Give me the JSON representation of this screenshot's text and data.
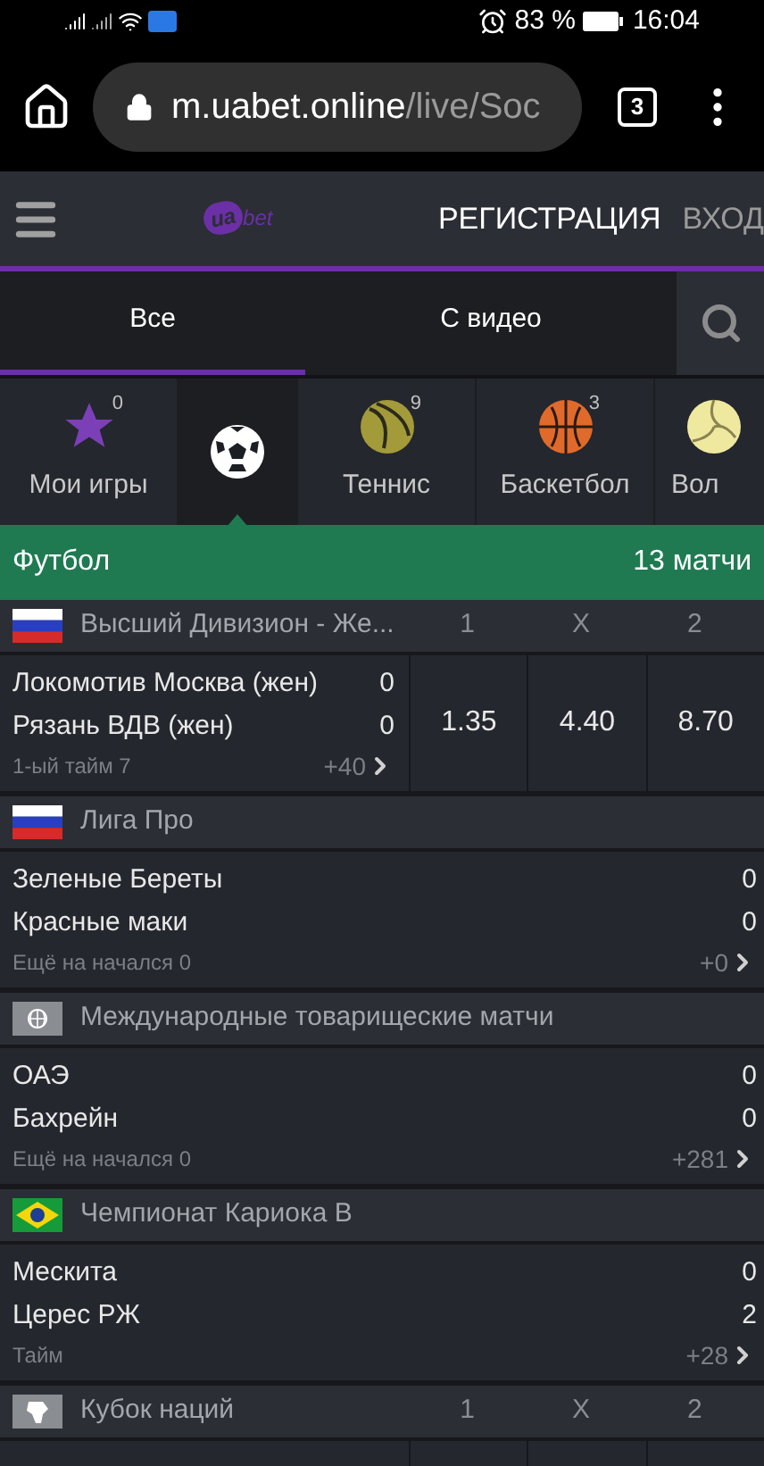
{
  "status_bar": {
    "battery": "83 %",
    "time": "16:04"
  },
  "browser": {
    "url_host": "m.uabet.online",
    "url_path": "/live/Soc",
    "tab_count": "3"
  },
  "header": {
    "logo_badge": "ua",
    "logo_text": "bet",
    "register": "РЕГИСТРАЦИЯ",
    "login": "ВХОД"
  },
  "tabs": [
    {
      "label": "Все",
      "selected": true
    },
    {
      "label": "С видео",
      "selected": false
    }
  ],
  "sports": [
    {
      "kind": "star",
      "label": "Мои игры",
      "count": "0",
      "selected": false
    },
    {
      "kind": "soccer",
      "selected": true
    },
    {
      "kind": "tennis",
      "label": "Теннис",
      "count": "9",
      "selected": false
    },
    {
      "kind": "basketball",
      "label": "Баскетбол",
      "count": "3",
      "selected": false
    },
    {
      "kind": "volleyball",
      "label": "Вол",
      "selected": false
    }
  ],
  "section": {
    "title": "Футбол",
    "count": "13 матчи"
  },
  "leagues": [
    {
      "kind": "russia",
      "name": "Высший Дивизион - Же...",
      "odds_headers": [
        "1",
        "X",
        "2"
      ],
      "matches": [
        {
          "teams": [
            {
              "name": "Локомотив Москва (жен)",
              "score": "0"
            },
            {
              "name": "Рязань ВДВ (жен)",
              "score": "0"
            }
          ],
          "status": "1-ый тайм 7",
          "more": "+40",
          "odds": [
            "1.35",
            "4.40",
            "8.70"
          ]
        }
      ]
    },
    {
      "kind": "russia",
      "name": "Лига Про",
      "matches": [
        {
          "teams": [
            {
              "name": "Зеленые Береты",
              "score": "0"
            },
            {
              "name": "Красные маки",
              "score": "0"
            }
          ],
          "status": "Ещё на начался 0",
          "more": "+0"
        }
      ]
    },
    {
      "kind": "world",
      "name": "Международные товарищеские матчи",
      "matches": [
        {
          "teams": [
            {
              "name": "ОАЭ",
              "score": "0"
            },
            {
              "name": "Бахрейн",
              "score": "0"
            }
          ],
          "status": "Ещё на начался 0",
          "more": "+281"
        }
      ]
    },
    {
      "kind": "brazil",
      "name": "Чемпионат Кариока B",
      "matches": [
        {
          "teams": [
            {
              "name": "Мескита",
              "score": "0"
            },
            {
              "name": "Церес РЖ",
              "score": "2"
            }
          ],
          "status": "Тайм",
          "more": "+28"
        }
      ]
    },
    {
      "kind": "africa",
      "name": "Кубок наций",
      "odds_headers": [
        "1",
        "X",
        "2"
      ]
    }
  ]
}
